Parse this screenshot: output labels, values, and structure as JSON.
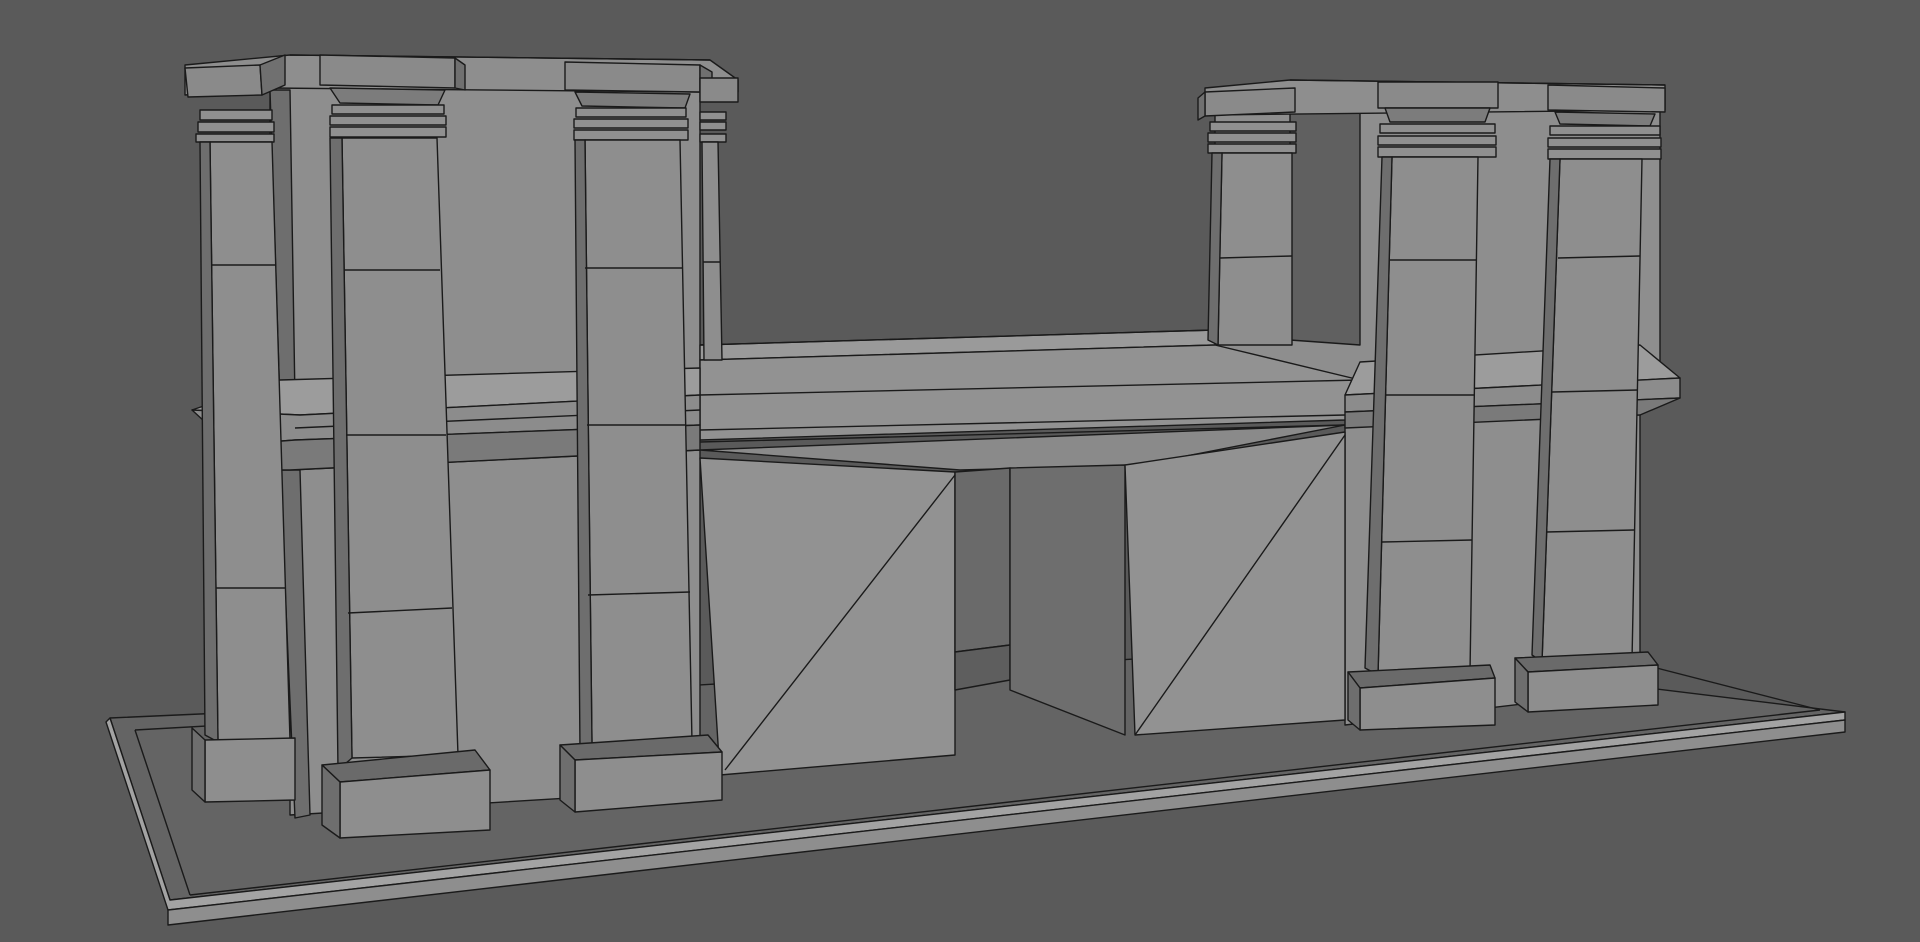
{
  "viewport": {
    "background": "#5a5a5a",
    "view": "perspective",
    "shading": "solid-with-wireframe"
  },
  "model": {
    "name": "",
    "colors": {
      "light": "#949494",
      "mid": "#8a8a8a",
      "dark": "#6e6e6e",
      "darker": "#5e5e5e",
      "edge": "#1a1a1a",
      "base_top": "#646464",
      "base_side": "#a3a3a3"
    },
    "left_block_columns": 4,
    "right_block_columns": 3,
    "has_central_archway": true
  }
}
